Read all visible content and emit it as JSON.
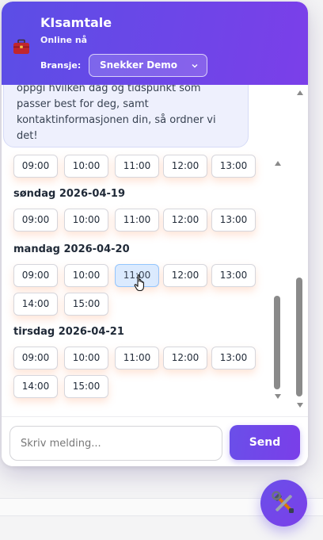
{
  "header": {
    "title": "KIsamtale",
    "status": "Online nå",
    "bransje_label": "Bransje:",
    "bransje_selected": "Snekker Demo"
  },
  "bubble": {
    "lines": [
      "oppgi hvilken dag og tidspunkt som",
      "passer best for deg, samt",
      "kontaktinformasjonen din, så ordner vi",
      "det!"
    ]
  },
  "schedule": {
    "partial_row": [
      "09:00",
      "10:00",
      "11:00",
      "12:00",
      "13:00"
    ],
    "days": [
      {
        "label": "søndag 2026-04-19",
        "times": [
          "09:00",
          "10:00",
          "11:00",
          "12:00",
          "13:00"
        ]
      },
      {
        "label": "mandag 2026-04-20",
        "times": [
          "09:00",
          "10:00",
          "11:00",
          "12:00",
          "13:00",
          "14:00",
          "15:00"
        ]
      },
      {
        "label": "tirsdag 2026-04-21",
        "times": [
          "09:00",
          "10:00",
          "11:00",
          "12:00",
          "13:00",
          "14:00",
          "15:00"
        ]
      }
    ],
    "hovered_slot": "mandag 2026-04-20 11:00"
  },
  "input": {
    "placeholder": "Skriv melding...",
    "value": ""
  },
  "send_label": "Send",
  "icons": {
    "header": "briefcase-icon",
    "fab": "tools-icon"
  },
  "colors": {
    "accent": "#6a4fe9",
    "accent_end": "#7b3fe9",
    "bubble_bg": "#eef0fd",
    "slot_hover": "#dbeafe"
  }
}
